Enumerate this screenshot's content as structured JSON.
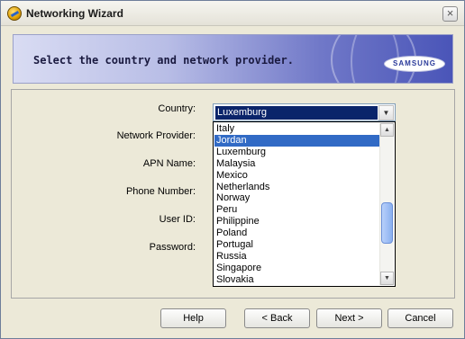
{
  "window": {
    "title": "Networking Wizard",
    "close_symbol": "×"
  },
  "banner": {
    "instruction": "Select the country and network provider.",
    "brand": "SAMSUNG"
  },
  "form": {
    "country_label": "Country:",
    "network_provider_label": "Network Provider:",
    "apn_label": "APN Name:",
    "phone_label": "Phone Number:",
    "userid_label": "User ID:",
    "password_label": "Password:",
    "country_value": "Luxemburg",
    "dropdown_arrow": "▼"
  },
  "country_options": [
    "Italy",
    "Jordan",
    "Luxemburg",
    "Malaysia",
    "Mexico",
    "Netherlands",
    "Norway",
    "Peru",
    "Philippine",
    "Poland",
    "Portugal",
    "Russia",
    "Singapore",
    "Slovakia"
  ],
  "highlighted_option": "Jordan",
  "scrollbar": {
    "up_symbol": "▲",
    "down_symbol": "▼"
  },
  "buttons": {
    "help": "Help",
    "back": "< Back",
    "next": "Next >",
    "cancel": "Cancel"
  },
  "colors": {
    "selection": "#316ac5",
    "field_selection": "#0a246a",
    "window_bg": "#ece9d8"
  }
}
